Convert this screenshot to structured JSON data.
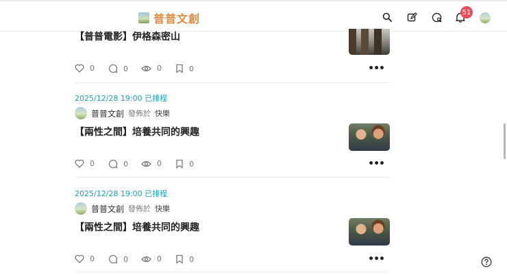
{
  "header": {
    "site_name": "普普文創",
    "notification_count": "51",
    "icons": [
      "search-icon",
      "edit-icon",
      "chat-icon",
      "bell-icon",
      "avatar"
    ]
  },
  "posts": [
    {
      "title": "【普普電影】伊格森密山",
      "likes": "0",
      "comments": "0",
      "views": "0",
      "saves": "0"
    },
    {
      "schedule": "2025/12/28 19:00 已排程",
      "author": "普普文創",
      "posted_in": "發佈於",
      "category": "快樂",
      "title": "【兩性之間】培養共同的興趣",
      "likes": "0",
      "comments": "0",
      "views": "0",
      "saves": "0"
    },
    {
      "schedule": "2025/12/28 19:00 已排程",
      "author": "普普文創",
      "posted_in": "發佈於",
      "category": "快樂",
      "title": "【兩性之間】培養共同的興趣",
      "likes": "0",
      "comments": "0",
      "views": "0",
      "saves": "0"
    }
  ],
  "more_label": "•••",
  "colors": {
    "brand": "#e08a3c",
    "schedule": "#1aa2b8",
    "badge": "#ef4b5a"
  }
}
